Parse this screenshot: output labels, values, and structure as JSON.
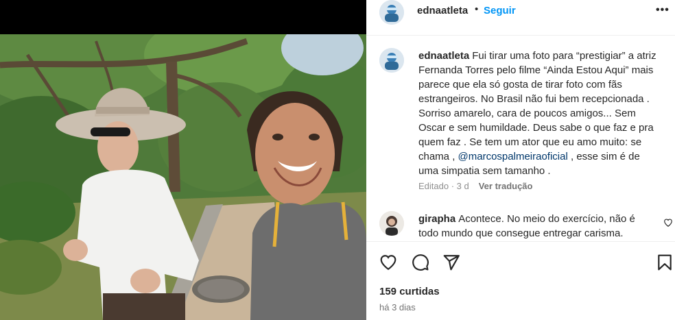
{
  "post": {
    "author": "ednaatleta",
    "separator": "•",
    "follow_label": "Seguir",
    "more_label": "•••",
    "photo_alt": "Duas mulheres caminhando em um parque arborizado",
    "likes": "159 curtidas",
    "posted_ago": "há 3 dias"
  },
  "caption": {
    "username": "ednaatleta",
    "text_before": "Fui tirar uma foto para “prestigiar” a atriz Fernanda Torres pelo filme “Ainda Estou Aqui” mais parece que ela só gosta de tirar foto com fãs estrangeiros. No Brasil não fui bem recepcionada . Sorriso amarelo, cara de poucos amigos... Sem Oscar e sem humildade. Deus sabe o que faz e pra quem faz . Se tem um ator que eu amo muito: se chama ,",
    "mention": "@marcospalmeiraoficial",
    "text_after": ", esse sim é de uma simpatia sem tamanho .",
    "edited_label": "Editado · 3 d",
    "translate_label": "Ver tradução"
  },
  "reply": {
    "username": "girapha",
    "text": "Acontece. No meio do exercício, não é todo mundo que consegue entregar carisma."
  },
  "icons": {
    "like": "heart-icon",
    "comment": "comment-icon",
    "share": "share-icon",
    "save": "bookmark-icon"
  },
  "colors": {
    "accent": "#0095f6",
    "text": "#262626",
    "muted": "#8e8e8e",
    "mention": "#00376b"
  }
}
